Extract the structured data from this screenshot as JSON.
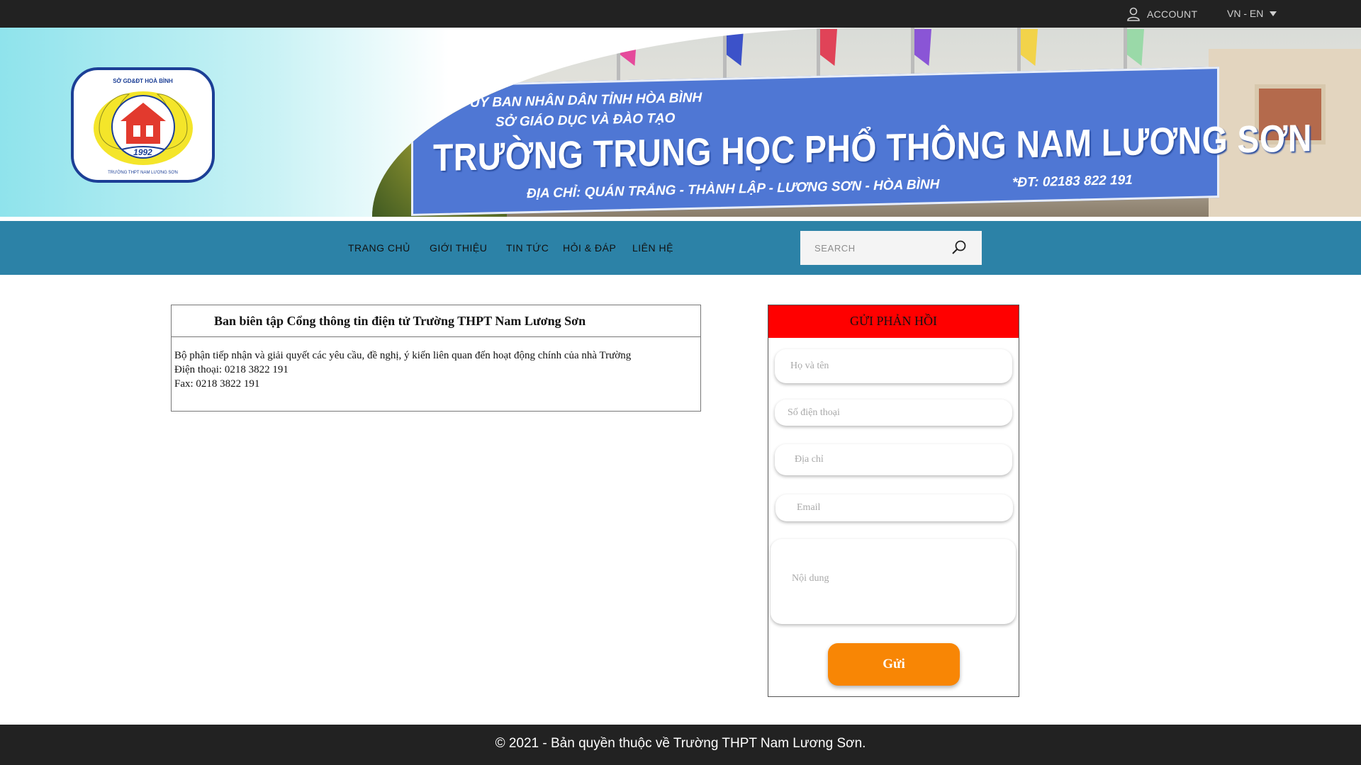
{
  "topbar": {
    "account_label": "ACCOUNT",
    "account_icon": "user-icon",
    "language_label": "VN - EN"
  },
  "banner": {
    "sign_line1": "ỦY BAN NHÂN DÂN TỈNH HÒA BÌNH",
    "sign_line2": "SỞ GIÁO DỤC VÀ ĐÀO TẠO",
    "sign_title": "TRƯỜNG TRUNG HỌC PHỔ THÔNG NAM LƯƠNG SƠN",
    "sign_address": "ĐỊA CHỈ: QUÁN TRẮNG - THÀNH LẬP - LƯƠNG SƠN - HÒA BÌNH",
    "sign_phone": "*ĐT: 02183 822 191",
    "logo_top": "SỞ GD&ĐT HOÀ BÌNH",
    "logo_year": "1992",
    "logo_bottom": "TRƯỜNG THPT NAM LƯƠNG SƠN"
  },
  "nav": {
    "items": [
      "TRANG CHỦ",
      "GIỚI THIỆU",
      "TIN TỨC",
      "HỎI & ĐÁP",
      "LIÊN HỆ"
    ],
    "search_placeholder": "SEARCH"
  },
  "info": {
    "title": "Ban biên tập Cổng thông tin điện tử Trường THPT Nam Lương Sơn",
    "line1": "Bộ phận tiếp nhận và giải quyết các yêu cầu, đề nghị, ý kiến liên quan đến hoạt động chính của nhà Trường",
    "line2": "Điện thoại: 0218 3822 191",
    "line3": "Fax: 0218 3822 191"
  },
  "feedback": {
    "title": "GỬI PHẢN HỒI",
    "name_placeholder": "Họ và tên",
    "phone_placeholder": "Số điện thoại",
    "address_placeholder": "Địa chỉ",
    "email_placeholder": "Email",
    "content_placeholder": "Nội dung",
    "submit_label": "Gửi"
  },
  "footer": {
    "copyright": "© 2021 - Bản quyền thuộc về Trường THPT Nam Lương Sơn."
  },
  "colors": {
    "topbar": "#222222",
    "nav": "#2c82a7",
    "form_header": "#ff0000",
    "submit": "#f88605"
  }
}
